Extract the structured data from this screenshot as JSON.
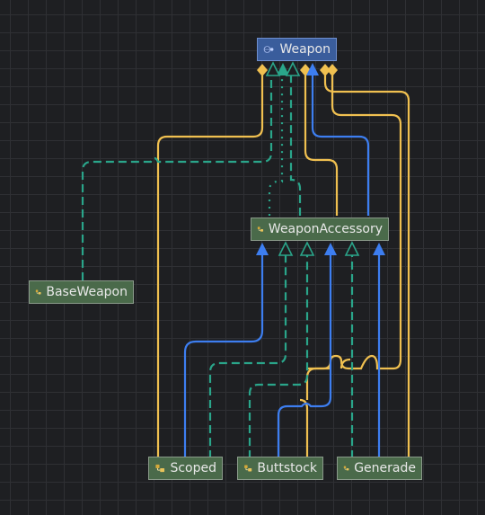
{
  "nodes": {
    "weapon": {
      "label": "Weapon",
      "icon": "interface-icon"
    },
    "weapon_accessory": {
      "label": "WeaponAccessory",
      "icon": "class-icon"
    },
    "base_weapon": {
      "label": "BaseWeapon",
      "icon": "class-icon"
    },
    "scoped": {
      "label": "Scoped",
      "icon": "class-icon"
    },
    "buttstock": {
      "label": "Buttstock",
      "icon": "class-icon"
    },
    "generade": {
      "label": "Generade",
      "icon": "class-icon"
    }
  },
  "colors": {
    "background": "#1e1f22",
    "grid": "#2f3034",
    "class_node": "#4a6a4a",
    "interface_node": "#3a5d9c",
    "aggregation": "#f0c050",
    "inheritance": "#3d7ef0",
    "implementation": "#2aa58a"
  },
  "legend_of_edges": {
    "aggregation": "yellow line with diamond",
    "inheritance": "blue line with arrow",
    "implementation": "teal dashed line with hollow arrow"
  }
}
